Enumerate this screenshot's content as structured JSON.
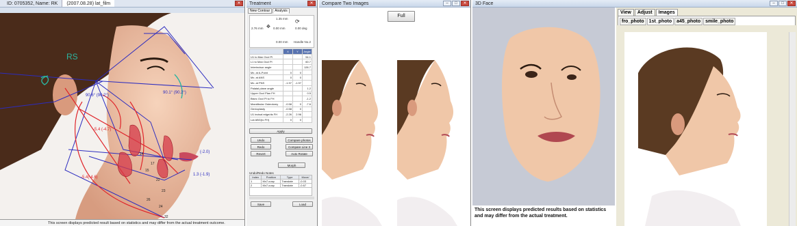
{
  "window1": {
    "tabs": [
      "ID: 0705352, Name: RK",
      "(2007.08.28) lat_film"
    ],
    "rs_label": "RS",
    "angle_labels": [
      "90.6° (90.2°)",
      "90.1° (90.2°)"
    ],
    "values": [
      "(-2.0)",
      "1.3 (-1.9)",
      "-5.4 (-4.7)",
      "-5.4(-4.6)"
    ],
    "points": [
      "14",
      "15",
      "17",
      "22",
      "23",
      "24",
      "26",
      "32"
    ],
    "note": "This screen displays predicted result based on statistics and may differ from the actual treatment outcome."
  },
  "window2": {
    "title": "Treatment",
    "tabs": [
      "New Contour",
      "Analysis"
    ],
    "move_values": [
      "1.35 mm",
      "2.76 mm",
      "0.00 mm",
      "0.00 deg",
      "0.00 mm",
      "Handle No.2"
    ],
    "table_headers": [
      "",
      "X",
      "Y",
      "Angle"
    ],
    "rows": [
      {
        "label": "U1 to Max Occl Pl",
        "x": "",
        "y": "",
        "angle": "54.1"
      },
      {
        "label": "L1 to Man Occl Pl",
        "x": "",
        "y": "",
        "angle": "60.7"
      },
      {
        "label": "Interincisor angle",
        "x": "",
        "y": "",
        "angle": "126.7"
      },
      {
        "label": "Mx. at A-Point",
        "x": "0",
        "y": "0",
        "angle": ""
      },
      {
        "label": "Mx. at ANS",
        "x": "0",
        "y": "0",
        "angle": ""
      },
      {
        "label": "Mx. at PNS",
        "x": "-1.97",
        "y": "-1.97",
        "angle": ""
      },
      {
        "label": "Palatal plane angle",
        "x": "",
        "y": "",
        "angle": "1.2"
      },
      {
        "label": "Upper Occl Plan FH",
        "x": "",
        "y": "",
        "angle": "0.5"
      },
      {
        "label": "Bisec Occl Pl to FH",
        "x": "",
        "y": "",
        "angle": "-1.2"
      },
      {
        "label": "Mandibular Osteotomy",
        "x": "-0.58",
        "y": "0",
        "angle": "-7.6"
      },
      {
        "label": "Genioplasty",
        "x": "-0.58",
        "y": "0",
        "angle": ""
      },
      {
        "label": "U1 incisal edge/ds FH",
        "x": "-2.26",
        "y": "2.96",
        "angle": ""
      },
      {
        "label": "Lat ABG(to FH)",
        "x": "0",
        "y": "0",
        "angle": ""
      }
    ],
    "apply": "Apply",
    "buttons": [
      [
        "Undo",
        "Compare photos"
      ],
      [
        "Redo",
        "Compare Line 3"
      ],
      [
        "Revert",
        "Auto Rotate"
      ]
    ],
    "morph": "Morph",
    "undo_title": "Undo/Redo Notes",
    "undo_headers": [
      "Index",
      "Position",
      "Type",
      "Move/"
    ],
    "undo_rows": [
      [
        "1",
        "Mx7-cusp",
        "Translate",
        "-0.03"
      ],
      [
        "2",
        "Mx7-cusp",
        "Translate",
        "-0.67"
      ]
    ],
    "save": "Save",
    "load": "Load"
  },
  "window3": {
    "title": "Compare Two Images",
    "full_button": "Full"
  },
  "window4": {
    "title": "3D Face",
    "tabs": [
      "View",
      "Adjust",
      "Images"
    ],
    "subtabs": [
      "fro_photo",
      "1st_photo",
      "a45_photo",
      "smile_photo"
    ],
    "note": "This screen displays predicted results based on statistics and may differ from the actual treatment.",
    "colors": {
      "skin": "#f0c7a8",
      "hair": "#5a3a22",
      "bg3d": "#c6cad5",
      "tracing_blue": "#2c2cbf",
      "tracing_red": "#e0242a"
    }
  }
}
